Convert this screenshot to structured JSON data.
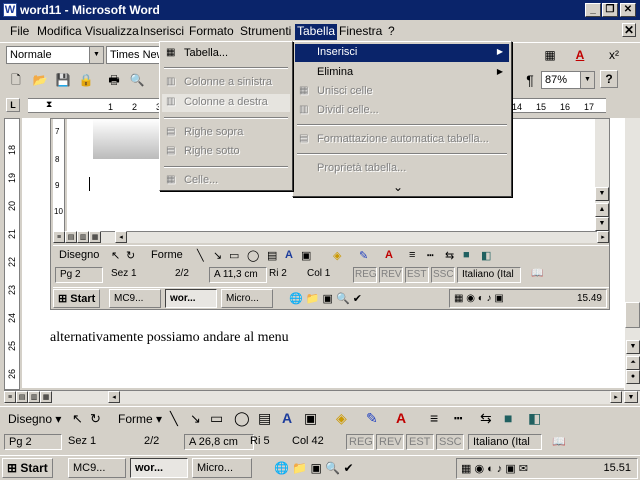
{
  "window": {
    "title": "word11 - Microsoft Word",
    "app_icon": "W"
  },
  "menubar": {
    "items": [
      "File",
      "Modifica",
      "Visualizza",
      "Inserisci",
      "Formato",
      "Strumenti",
      "Tabella",
      "Finestra",
      "?"
    ],
    "active": "Tabella"
  },
  "toolbar": {
    "style": "Normale",
    "font": "Times New",
    "zoom": "87%",
    "pilcrow": "¶",
    "help": "?"
  },
  "ruler": {
    "marks": [
      "1",
      "2",
      "3",
      "14",
      "15",
      "16",
      "17"
    ]
  },
  "table_menu": {
    "items": [
      "Tabella...",
      "Colonne a sinistra",
      "Colonne a destra",
      "Righe sopra",
      "Righe sotto",
      "Celle..."
    ]
  },
  "tabella_menu": {
    "items": [
      "Inserisci",
      "Elimina",
      "Unisci celle",
      "Dividi celle...",
      "Formattazione automatica tabella...",
      "Proprietà tabella..."
    ],
    "more": "⌄"
  },
  "inner_vruler": {
    "marks": [
      "7",
      "8",
      "9",
      "10"
    ]
  },
  "drawing": {
    "label": "Disegno",
    "forme": "Forme"
  },
  "inner_status": {
    "pg": "Pg 2",
    "sez": "Sez 1",
    "pages": "2/2",
    "pos": "A 11,3 cm",
    "ri": "Ri 2",
    "col": "Col 1",
    "reg": "REG",
    "rev": "REV",
    "est": "EST",
    "ssc": "SSC",
    "lang": "Italiano (Ital"
  },
  "inner_taskbar": {
    "start": "Start",
    "tasks": [
      "MC9...",
      "wor...",
      "Micro..."
    ],
    "time": "15.49"
  },
  "body": {
    "text": "alternativamente possiamo andare al menu"
  },
  "vruler": {
    "marks": [
      "18",
      "19",
      "20",
      "21",
      "22",
      "23",
      "24",
      "25",
      "26"
    ]
  },
  "statusbar": {
    "pg": "Pg 2",
    "sez": "Sez 1",
    "pages": "2/2",
    "pos": "A 26,8 cm",
    "ri": "Ri 5",
    "col": "Col 42",
    "reg": "REG",
    "rev": "REV",
    "est": "EST",
    "ssc": "SSC",
    "lang": "Italiano (Ital"
  },
  "taskbar": {
    "start": "Start",
    "tasks": [
      "MC9...",
      "wor...",
      "Micro..."
    ],
    "time": "15.51"
  }
}
